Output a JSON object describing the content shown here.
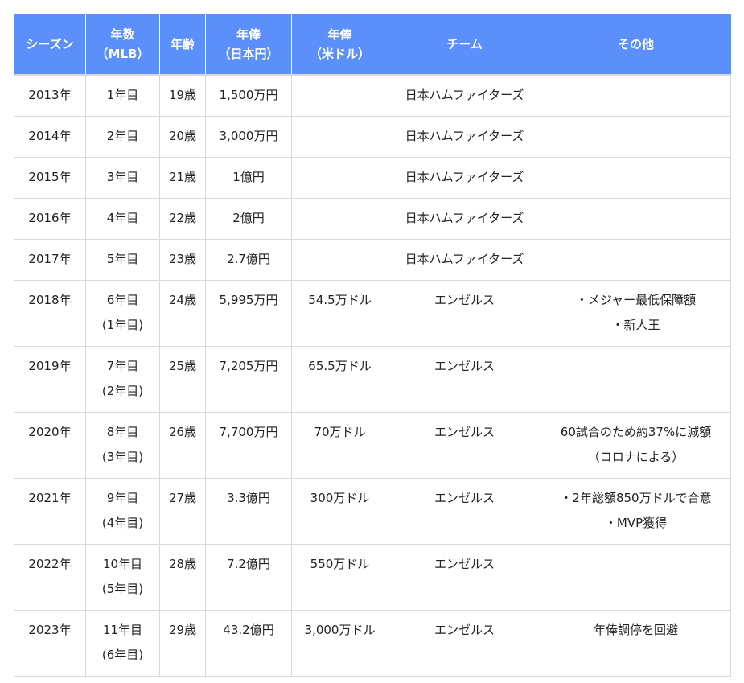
{
  "table": {
    "headers": [
      [
        "シーズン"
      ],
      [
        "年数",
        "（MLB）"
      ],
      [
        "年齢"
      ],
      [
        "年俸",
        "（日本円）"
      ],
      [
        "年俸",
        "（米ドル）"
      ],
      [
        "チーム"
      ],
      [
        "その他"
      ]
    ],
    "rows": [
      [
        [
          "2013年"
        ],
        [
          "1年目"
        ],
        [
          "19歳"
        ],
        [
          "1,500万円"
        ],
        [
          ""
        ],
        [
          "日本ハムファイターズ"
        ],
        [
          ""
        ]
      ],
      [
        [
          "2014年"
        ],
        [
          "2年目"
        ],
        [
          "20歳"
        ],
        [
          "3,000万円"
        ],
        [
          ""
        ],
        [
          "日本ハムファイターズ"
        ],
        [
          ""
        ]
      ],
      [
        [
          "2015年"
        ],
        [
          "3年目"
        ],
        [
          "21歳"
        ],
        [
          "1億円"
        ],
        [
          ""
        ],
        [
          "日本ハムファイターズ"
        ],
        [
          ""
        ]
      ],
      [
        [
          "2016年"
        ],
        [
          "4年目"
        ],
        [
          "22歳"
        ],
        [
          "2億円"
        ],
        [
          ""
        ],
        [
          "日本ハムファイターズ"
        ],
        [
          ""
        ]
      ],
      [
        [
          "2017年"
        ],
        [
          "5年目"
        ],
        [
          "23歳"
        ],
        [
          "2.7億円"
        ],
        [
          ""
        ],
        [
          "日本ハムファイターズ"
        ],
        [
          ""
        ]
      ],
      [
        [
          "2018年"
        ],
        [
          "6年目",
          "(1年目)"
        ],
        [
          "24歳"
        ],
        [
          "5,995万円"
        ],
        [
          "54.5万ドル"
        ],
        [
          "エンゼルス"
        ],
        [
          "・メジャー最低保障額",
          "・新人王"
        ]
      ],
      [
        [
          "2019年"
        ],
        [
          "7年目",
          "(2年目)"
        ],
        [
          "25歳"
        ],
        [
          "7,205万円"
        ],
        [
          "65.5万ドル"
        ],
        [
          "エンゼルス"
        ],
        [
          ""
        ]
      ],
      [
        [
          "2020年"
        ],
        [
          "8年目",
          "(3年目)"
        ],
        [
          "26歳"
        ],
        [
          "7,700万円"
        ],
        [
          "70万ドル"
        ],
        [
          "エンゼルス"
        ],
        [
          "60試合のため約37%に減額",
          "（コロナによる）"
        ]
      ],
      [
        [
          "2021年"
        ],
        [
          "9年目",
          "(4年目)"
        ],
        [
          "27歳"
        ],
        [
          "3.3億円"
        ],
        [
          "300万ドル"
        ],
        [
          "エンゼルス"
        ],
        [
          "・2年総額850万ドルで合意",
          "・MVP獲得"
        ]
      ],
      [
        [
          "2022年"
        ],
        [
          "10年目",
          "(5年目)"
        ],
        [
          "28歳"
        ],
        [
          "7.2億円"
        ],
        [
          "550万ドル"
        ],
        [
          "エンゼルス"
        ],
        [
          ""
        ]
      ],
      [
        [
          "2023年"
        ],
        [
          "11年目",
          "(6年目)"
        ],
        [
          "29歳"
        ],
        [
          "43.2億円"
        ],
        [
          "3,000万ドル"
        ],
        [
          "エンゼルス"
        ],
        [
          "年俸調停を回避"
        ]
      ]
    ]
  },
  "colors": {
    "header_bg": "#5b8ff9",
    "header_text": "#ffffff",
    "border": "#d9d9d9",
    "text": "#222222"
  }
}
